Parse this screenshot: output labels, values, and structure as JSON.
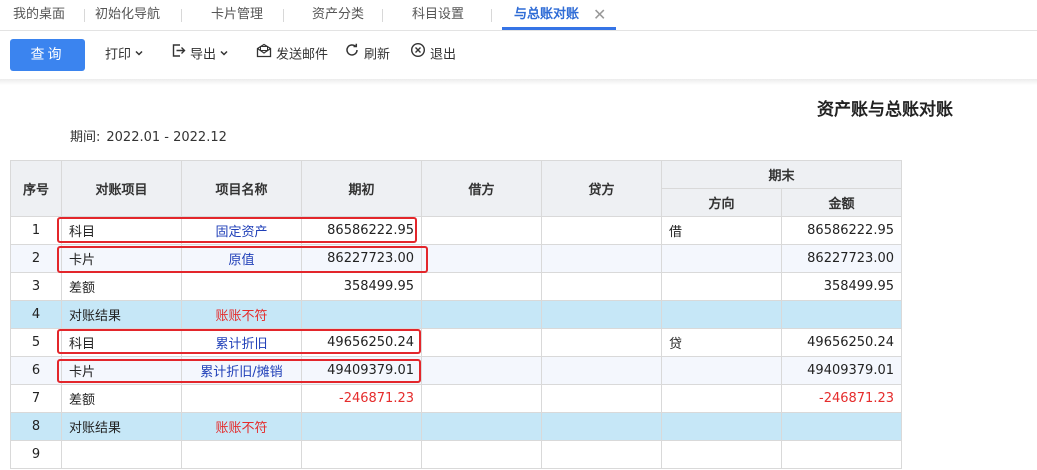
{
  "tabs": [
    {
      "label": "我的桌面"
    },
    {
      "label": "初始化导航"
    },
    {
      "label": "卡片管理"
    },
    {
      "label": "资产分类"
    },
    {
      "label": "科目设置"
    },
    {
      "label": "与总账对账"
    }
  ],
  "toolbar": {
    "query": "查询",
    "print": "打印",
    "export": "导出",
    "email": "发送邮件",
    "refresh": "刷新",
    "exit": "退出"
  },
  "report": {
    "title": "资产账与总账对账",
    "period_label": "期间:",
    "period_value": "2022.01 - 2022.12"
  },
  "table": {
    "headers": {
      "seq": "序号",
      "item": "对账项目",
      "name": "项目名称",
      "opening": "期初",
      "debit": "借方",
      "credit": "贷方",
      "ending": "期末",
      "direction": "方向",
      "amount": "金额"
    },
    "rows": [
      {
        "seq": "1",
        "item": "科目",
        "name": "固定资产",
        "opening": "86586222.95",
        "debit": "",
        "credit": "",
        "direction": "借",
        "amount": "86586222.95"
      },
      {
        "seq": "2",
        "item": "卡片",
        "name": "原值",
        "opening": "86227723.00",
        "debit": "",
        "credit": "",
        "direction": "",
        "amount": "86227723.00"
      },
      {
        "seq": "3",
        "item": "差额",
        "name": "",
        "opening": "358499.95",
        "debit": "",
        "credit": "",
        "direction": "",
        "amount": "358499.95"
      },
      {
        "seq": "4",
        "item": "对账结果",
        "name": "账账不符",
        "opening": "",
        "debit": "",
        "credit": "",
        "direction": "",
        "amount": ""
      },
      {
        "seq": "5",
        "item": "科目",
        "name": "累计折旧",
        "opening": "49656250.24",
        "debit": "",
        "credit": "",
        "direction": "贷",
        "amount": "49656250.24"
      },
      {
        "seq": "6",
        "item": "卡片",
        "name": "累计折旧/摊销",
        "opening": "49409379.01",
        "debit": "",
        "credit": "",
        "direction": "",
        "amount": "49409379.01"
      },
      {
        "seq": "7",
        "item": "差额",
        "name": "",
        "opening": "-246871.23",
        "debit": "",
        "credit": "",
        "direction": "",
        "amount": "-246871.23"
      },
      {
        "seq": "8",
        "item": "对账结果",
        "name": "账账不符",
        "opening": "",
        "debit": "",
        "credit": "",
        "direction": "",
        "amount": ""
      },
      {
        "seq": "9",
        "item": "",
        "name": "",
        "opening": "",
        "debit": "",
        "credit": "",
        "direction": "",
        "amount": ""
      }
    ]
  },
  "colors": {
    "accent": "#3b84ef",
    "highlight_border": "#e3262b",
    "result_row": "#c6e7f7",
    "negative_text": "#e52c2c",
    "link_text": "#1f3fb8"
  },
  "icons": [
    "chevron-down-icon",
    "export-icon",
    "email-icon",
    "refresh-icon",
    "exit-icon",
    "close-icon"
  ]
}
